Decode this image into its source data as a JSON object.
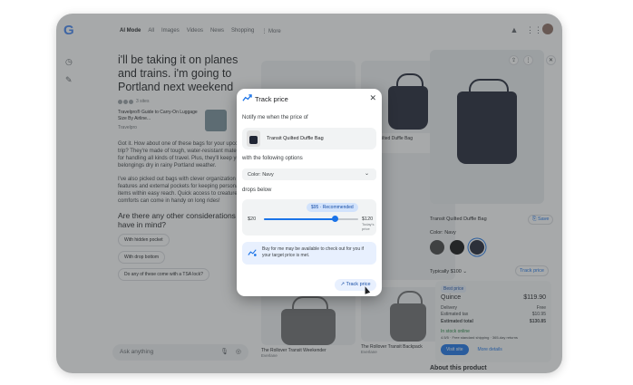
{
  "topbar": {
    "logo": "G",
    "tabs": [
      "AI Mode",
      "All",
      "Images",
      "Videos",
      "News",
      "Shopping",
      "⋮ More"
    ]
  },
  "chat": {
    "question": "i'll be taking it on planes and trains. i'm going to Portland next weekend",
    "sites_count": "3 sites",
    "source_title": "Travelpro® Guide to Carry-On Luggage Size By Airline...",
    "source_name": "Travelpro",
    "answer_1": "Got it. How about one of these bags for your upcoming trip? They're made of tough, water-resistant materials for handling all kinds of travel. Plus, they'll keep your belongings dry in rainy Portland weather.",
    "answer_2": "I've also picked out bags with clever organization features and external pockets for keeping personal items within easy reach. Quick access to creature comforts can come in handy on long rides!",
    "followup_q": "Are there any other considerations you have in mind?",
    "chips": [
      "With hidden pocket",
      "With drop bottom",
      "Do any of these come with a TSA lock?"
    ],
    "ask_placeholder": "Ask anything"
  },
  "grid": {
    "products": [
      {
        "name": "Transit Quilted Duffle Bag",
        "sub": "Quince"
      },
      {
        "name": "The Rollover Transit Weekender",
        "sub": "Everlane"
      },
      {
        "name": "The Rollover Transit Backpack",
        "sub": "Everlane"
      }
    ]
  },
  "panel": {
    "product_name": "Transit Quilted Duffle Bag",
    "save_label": "Save",
    "color_label": "Color: Navy",
    "typical_label": "Typically $100 ⌄",
    "track_label": "Track price",
    "best_price": "Best price",
    "seller": "Quince",
    "price": "$119.90",
    "delivery_label": "Delivery",
    "delivery_value": "Free",
    "tax_label": "Estimated tax",
    "tax_value": "$10.95",
    "total_label": "Estimated total",
    "total_value": "$130.85",
    "stock": "In stock online",
    "rating": "4.5/5 · Free standard shipping · 365-day returns",
    "visit": "Visit site",
    "more": "More details",
    "about": "About this product",
    "brand": "Quince"
  },
  "modal": {
    "title": "Track price",
    "notify": "Notify me when the price of",
    "item_name": "Transit Quilted Duffle Bag",
    "with_options": "with the following options",
    "color_option": "Color: Navy",
    "drops_below": "drops below",
    "recommended": "$95 · Recommended",
    "min_label": "$20",
    "max_label": "$120",
    "max_sub": "Today's price",
    "info": "Buy for me may be available to check out for you if your target price is met.",
    "button": "Track price",
    "slider_value_fraction": 0.75
  },
  "colors": {
    "accent": "#1a73e8",
    "navy_bag": "#1f2433",
    "overlay": "rgba(60,64,67,0.45)"
  }
}
